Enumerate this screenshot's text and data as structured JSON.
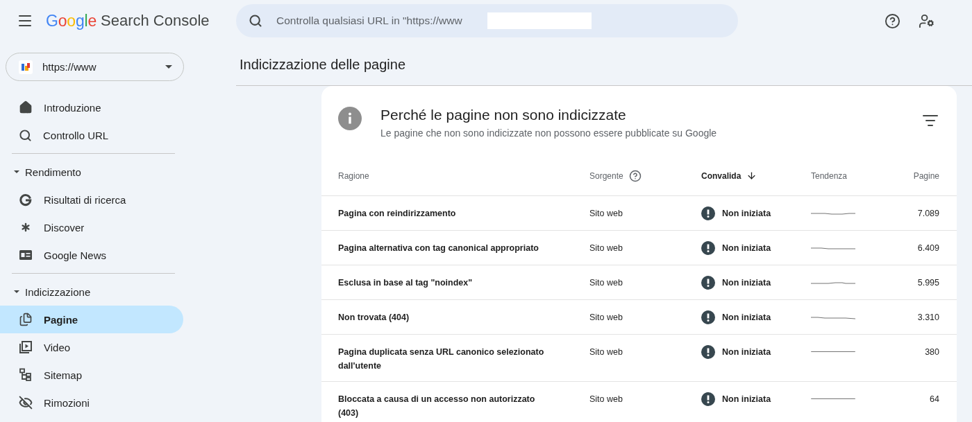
{
  "header": {
    "logo": "Google",
    "product": "Search Console",
    "search": {
      "placeholder": "Controlla qualsiasi URL in \"https://www"
    }
  },
  "sidebar": {
    "property": {
      "label": "https://www"
    },
    "nav": [
      {
        "label": "Introduzione",
        "selected": false
      },
      {
        "label": "Controllo URL",
        "selected": false
      }
    ],
    "sections": [
      {
        "label": "Rendimento",
        "expanded": true,
        "children": [
          {
            "label": "Risultati di ricerca",
            "selected": false
          },
          {
            "label": "Discover",
            "selected": false
          },
          {
            "label": "Google News",
            "selected": false
          }
        ]
      },
      {
        "label": "Indicizzazione",
        "expanded": true,
        "children": [
          {
            "label": "Pagine",
            "selected": true
          },
          {
            "label": "Video",
            "selected": false
          },
          {
            "label": "Sitemap",
            "selected": false
          },
          {
            "label": "Rimozioni",
            "selected": false
          }
        ]
      }
    ]
  },
  "page": {
    "title": "Indicizzazione delle pagine"
  },
  "card": {
    "title": "Perché le pagine non sono indicizzate",
    "subtitle": "Le pagine che non sono indicizzate non possono essere pubblicate su Google",
    "table": {
      "columns": [
        {
          "label": "Ragione",
          "sorted": false,
          "help": false
        },
        {
          "label": "Sorgente",
          "sorted": false,
          "help": true
        },
        {
          "label": "Convalida",
          "sorted": true,
          "help": false
        },
        {
          "label": "Tendenza",
          "sorted": false,
          "help": false
        },
        {
          "label": "Pagine",
          "sorted": false,
          "help": false
        }
      ],
      "rows": [
        {
          "reason": "Pagina con reindirizzamento",
          "source": "Sito web",
          "status": "Non iniziata",
          "pages": "7.089"
        },
        {
          "reason": "Pagina alternativa con tag canonical appropriato",
          "source": "Sito web",
          "status": "Non iniziata",
          "pages": "6.409"
        },
        {
          "reason": "Esclusa in base al tag \"noindex\"",
          "source": "Sito web",
          "status": "Non iniziata",
          "pages": "5.995"
        },
        {
          "reason": "Non trovata (404)",
          "source": "Sito web",
          "status": "Non iniziata",
          "pages": "3.310"
        },
        {
          "reason": "Pagina duplicata senza URL canonico selezionato dall'utente",
          "source": "Sito web",
          "status": "Non iniziata",
          "pages": "380"
        },
        {
          "reason": "Bloccata a causa di un accesso non autorizzato (403)",
          "source": "Sito web",
          "status": "Non iniziata",
          "pages": "64"
        }
      ]
    }
  }
}
